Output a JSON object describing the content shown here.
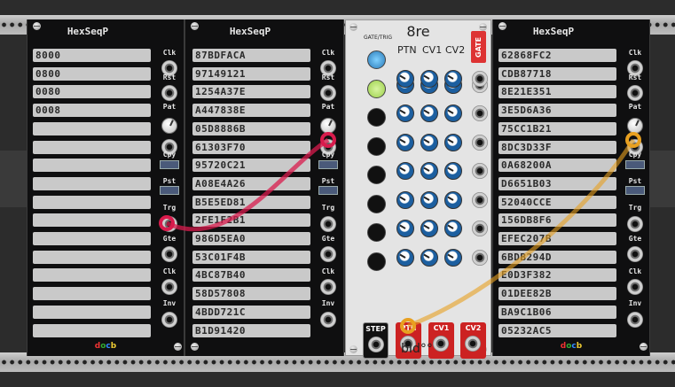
{
  "colors": {
    "cable_red": "#d81b4c",
    "cable_orange": "#e8a020",
    "gate_red": "#d33333",
    "field_bg": "#c9c9c9"
  },
  "left_seq": {
    "title": "HexSeqP",
    "fields": [
      "8000",
      "0800",
      "0080",
      "0008",
      "",
      "",
      "",
      "",
      "",
      "",
      "",
      "",
      "",
      "",
      "",
      ""
    ],
    "side_labels": [
      "Clk",
      "Rst",
      "Pat",
      "Cpy",
      "Pst",
      "Trg",
      "Gte",
      "Clk",
      "Inv"
    ]
  },
  "mid_seq": {
    "title": "HexSeqP",
    "fields": [
      "87BDFACA",
      "97149121",
      "1254A37E",
      "A447838E",
      "05D8886B",
      "61303F70",
      "95720C21",
      "A08E4A26",
      "B5E5ED81",
      "2FE1F2B1",
      "986D5EA0",
      "53C01F4B",
      "4BC87B40",
      "58D57808",
      "4BDD721C",
      "B1D91420"
    ],
    "side_labels": [
      "Clk",
      "Rst",
      "Pat",
      "Cpy",
      "Pst",
      "Trg",
      "Gte",
      "Clk",
      "Inv"
    ]
  },
  "right_seq": {
    "title": "HexSeqP",
    "fields": [
      "62868FC2",
      "CDB87718",
      "8E21E351",
      "3E5D6A36",
      "75CC1B21",
      "8DC3D33F",
      "0A68200A",
      "D6651B03",
      "52040CCE",
      "156DB8F6",
      "EFEC207B",
      "6BDB294D",
      "E0D3F382",
      "01DEE82B",
      "BA9C1B06",
      "05232AC5"
    ],
    "side_labels": [
      "Clk",
      "Rst",
      "Pat",
      "Cpy",
      "Pst",
      "Trg",
      "Gte",
      "Clk",
      "Inv"
    ]
  },
  "eightre": {
    "title": "8re",
    "gate_trig_label": "GATE/TRIG",
    "col_headers": [
      "PTN",
      "CV1",
      "CV2"
    ],
    "gate_label": "GATE",
    "out_labels": [
      "STEP",
      "PTN",
      "CV1",
      "CV2"
    ],
    "brand": "bId°°"
  },
  "logo_text": [
    "d",
    "o",
    "c",
    "b"
  ]
}
